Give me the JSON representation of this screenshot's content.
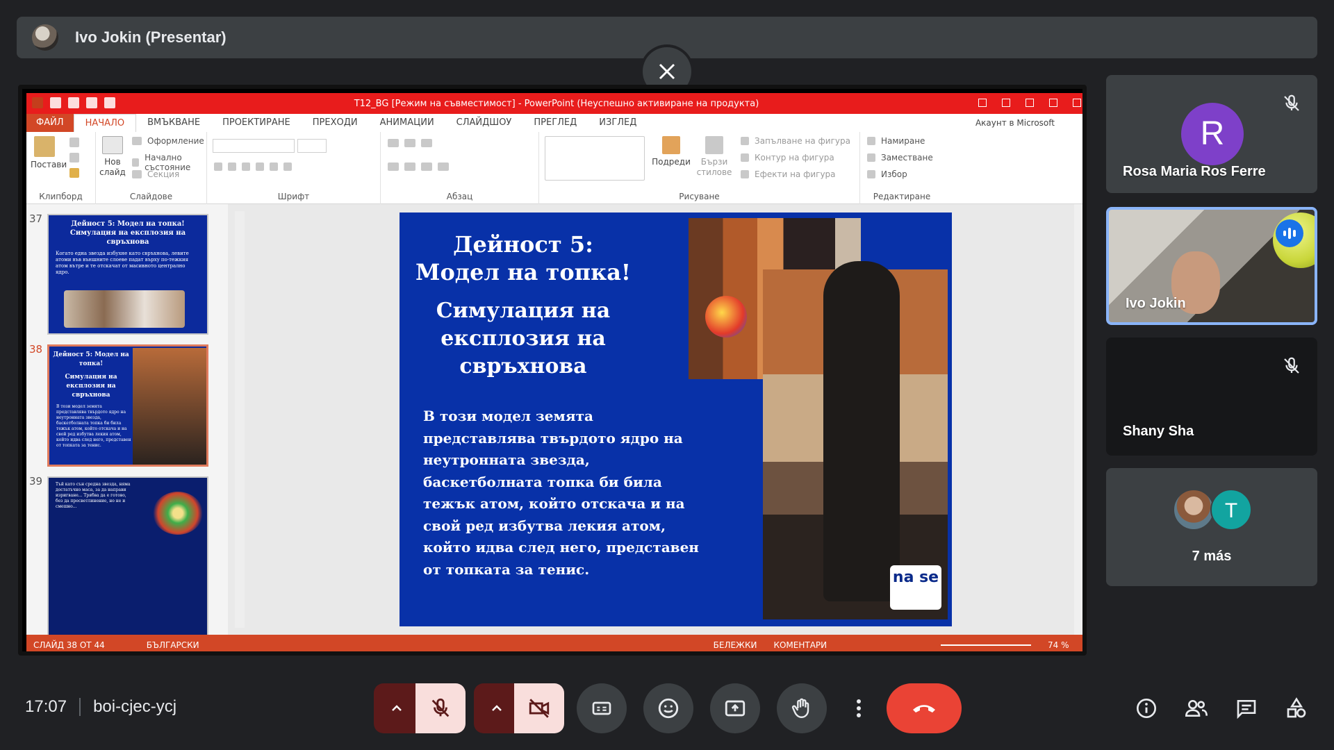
{
  "presenter": {
    "name": "Ivo Jokin (Presentar)"
  },
  "ppt": {
    "window_title": "T12_BG [Режим на съвместимост] - PowerPoint (Неуспешно активиране на продукта)",
    "tabs": [
      "ФАЙЛ",
      "НАЧАЛО",
      "ВМЪКВАНЕ",
      "ПРОЕКТИРАНЕ",
      "ПРЕХОДИ",
      "АНИМАЦИИ",
      "СЛАЙДШОУ",
      "ПРЕГЛЕД",
      "ИЗГЛЕД"
    ],
    "account": "Акаунт в Microsoft",
    "ribbon": {
      "clipboard": {
        "paste": "Постави",
        "label": "Клипборд"
      },
      "slides": {
        "new_slide_1": "Нов",
        "new_slide_2": "слайд",
        "layout": "Оформление",
        "reset": "Начално състояние",
        "section": "Секция",
        "label": "Слайдове"
      },
      "font": {
        "label": "Шрифт"
      },
      "paragraph": {
        "label": "Абзац"
      },
      "drawing": {
        "arrange": "Подреди",
        "quick_styles_1": "Бързи",
        "quick_styles_2": "стилове",
        "fill": "Запълване на фигура",
        "outline": "Контур на фигура",
        "effects": "Ефекти на фигура",
        "label": "Рисуване"
      },
      "editing": {
        "find": "Намиране",
        "replace": "Заместване",
        "select": "Избор",
        "label": "Редактиране"
      }
    },
    "thumbnails": [
      {
        "num": "37",
        "title": "Дейност 5: Модел на топка! Симулация на експлозия на свръхнова",
        "text": "Когато една звезда избухне като свръхнова, левите атоми във външните слоеве падат върху по-тежкия атом вътре и те отскачат от масивното централно ядро."
      },
      {
        "num": "38",
        "title": "Дейност 5: Модел на топка!",
        "subtitle": "Симулация на експлозия на свръхнова",
        "text": "В този модел земята представлява твърдото ядро на неутронната звезда, баскетболната топка би била тежък атом, който отскача и на свой ред избутва лекия атом, който идва след него, представен от топката за тенис."
      },
      {
        "num": "39",
        "text": "Тъй като сън средна звезда, няма достатъчно маса, за да направи изригване... Трябва да е готово, без да пресветлинение, но не и смешно..."
      }
    ],
    "slide": {
      "title": "Дейност 5: Модел на топка!",
      "subtitle": "Симулация на експлозия на свръхнова",
      "body": "В този модел земята представлява твърдото ядро на неутронната звезда, баскетболната топка би била тежък атом, който отскача и на свой ред избутва лекия атом, който идва след него, представен от топката за тенис.",
      "logo": "na se"
    },
    "status": {
      "slide_counter": "СЛАЙД 38 ОТ 44",
      "language": "БЪЛГАРСКИ",
      "notes": "БЕЛЕЖКИ",
      "comments": "КОМЕНТАРИ",
      "zoom": "74 %"
    }
  },
  "participants": [
    {
      "name": "Rosa Maria Ros Ferre",
      "initial": "R",
      "avatar_color": "#7e40c9",
      "muted": true
    },
    {
      "name": "Ivo Jokin",
      "speaking": true
    },
    {
      "name": "Shany Sha",
      "muted": true
    },
    {
      "others_initial": "T",
      "more_label": "7 más"
    }
  ],
  "meeting": {
    "time": "17:07",
    "code": "boi-cjec-ycj"
  },
  "colors": {
    "end_call": "#ea4335",
    "accent": "#8ab4f8",
    "ppt_orange": "#d24726"
  }
}
